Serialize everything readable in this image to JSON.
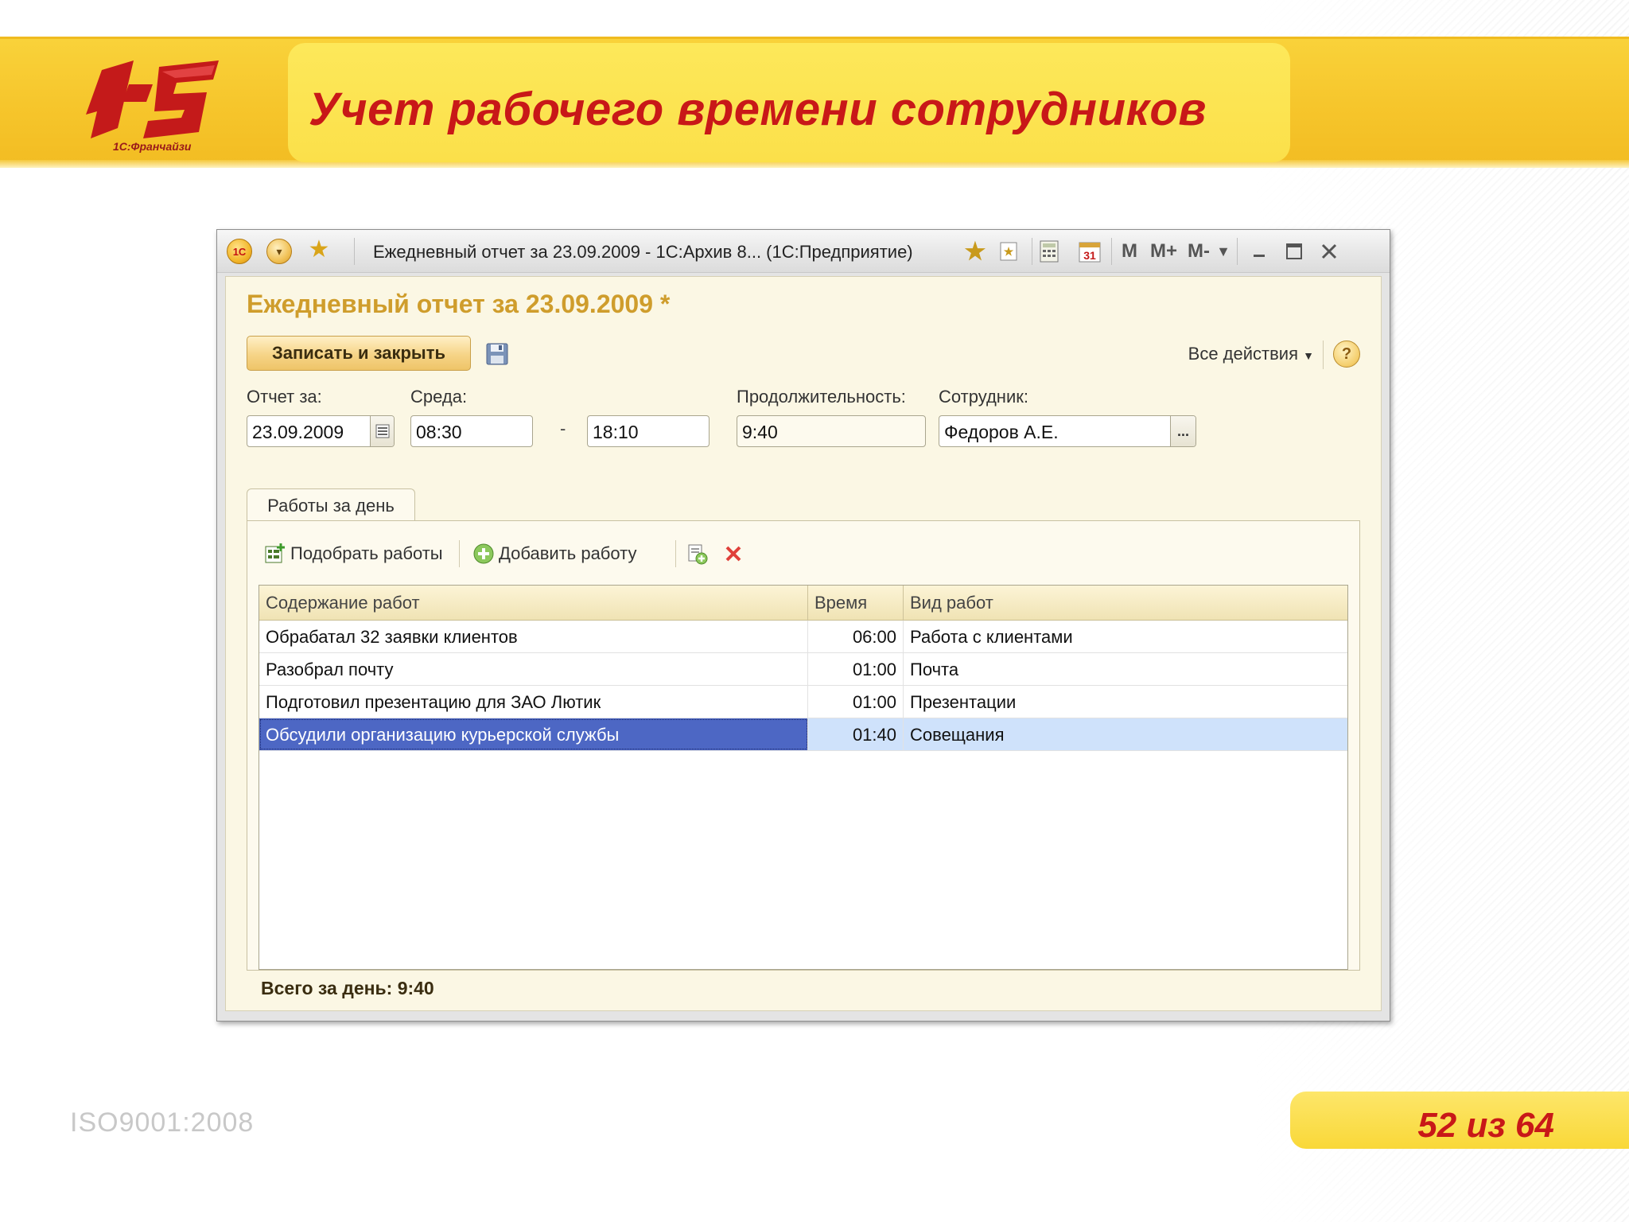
{
  "slide": {
    "title": "Учет рабочего времени сотрудников",
    "logo_caption": "1С:Франчайзи",
    "iso": "ISO9001:2008",
    "page": "52 из 64"
  },
  "window": {
    "title": "Ежедневный отчет за 23.09.2009 - 1С:Архив 8...  (1С:Предприятие)",
    "toolbar_icons": [
      "1c-logo-icon",
      "main-menu-icon",
      "favorites-star-icon",
      "add-to-favorites-icon",
      "bookmark-icon",
      "calculator-icon",
      "calendar-icon",
      "M",
      "M+",
      "M-",
      "chevron-down-icon",
      "minimize-icon",
      "maximize-icon",
      "close-icon"
    ],
    "calendar_day": "31"
  },
  "form": {
    "title": "Ежедневный отчет за 23.09.2009 *",
    "save_close_label": "Записать и закрыть",
    "all_actions_label": "Все действия",
    "help_label": "?",
    "report_date_label": "Отчет за:",
    "report_date_value": "23.09.2009",
    "environment_label": "Среда:",
    "time_from": "08:30",
    "time_to": "18:10",
    "dash": "-",
    "duration_label": "Продолжительность:",
    "duration_value": "9:40",
    "employee_label": "Сотрудник:",
    "employee_value": "Федоров А.Е.",
    "employee_select": "...",
    "tab_label": "Работы за день",
    "pick_works_label": "Подобрать работы",
    "add_work_label": "Добавить работу",
    "total_label": "Всего за день: 9:40"
  },
  "table": {
    "columns": [
      "Содержание работ",
      "Время",
      "Вид работ"
    ],
    "rows": [
      {
        "content": "Обрабатал 32 заявки клиентов",
        "time": "06:00",
        "type": "Работа с клиентами"
      },
      {
        "content": "Разобрал почту",
        "time": "01:00",
        "type": "Почта"
      },
      {
        "content": "Подготовил презентацию для ЗАО Лютик",
        "time": "01:00",
        "type": "Презентации"
      },
      {
        "content": "Обсудили организацию курьерской службы",
        "time": "01:40",
        "type": "Совещания"
      }
    ],
    "selected_row": 3
  },
  "colors": {
    "accent_yellow": "#f6c52b",
    "title_red": "#c81818",
    "form_title_gold": "#cf9d2c",
    "selection_blue": "#4d67c4"
  }
}
